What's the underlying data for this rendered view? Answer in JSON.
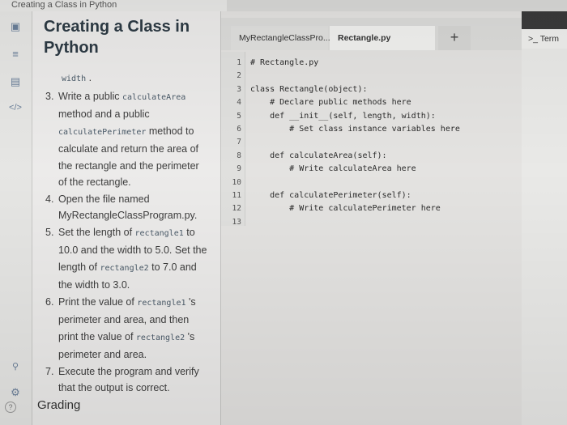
{
  "window": {
    "title": "Creating a Class in Python"
  },
  "lesson": {
    "title_line1": "Creating a Class in",
    "title_line2": "Python",
    "width_code": "width",
    "steps": [
      {
        "num": "3.",
        "t1": "Write a public",
        "c1": "calculateArea",
        "t2": "method and a public",
        "c2": "calculatePerimeter",
        "t3": "method to",
        "t4": "calculate and return the area of",
        "t5": "the rectangle and the perimeter",
        "t6": "of the rectangle."
      },
      {
        "num": "4.",
        "t1": "Open the file named",
        "t2": "MyRectangleClassProgram.py."
      },
      {
        "num": "5.",
        "t1": "Set the length of",
        "c1": "rectangle1",
        "t2": "to",
        "t3": "10.0 and the width to 5.0. Set the",
        "t4": "length of",
        "c2": "rectangle2",
        "t5": "to 7.0 and",
        "t6": "the width to 3.0."
      },
      {
        "num": "6.",
        "t1": "Print the value of",
        "c1": "rectangle1",
        "t2": "'s",
        "t3": "perimeter and area, and then",
        "t4": "print the value of",
        "c2": "rectangle2",
        "t5": "'s",
        "t6": "perimeter and area."
      },
      {
        "num": "7.",
        "t1": "Execute the program and verify",
        "t2": "that the output is correct."
      }
    ],
    "grading": "Grading"
  },
  "editor": {
    "tabs": [
      "MyRectangleClassPro...",
      "Rectangle.py"
    ],
    "add_tab": "+",
    "line_numbers": [
      "1",
      "2",
      "3",
      "4",
      "5",
      "6",
      "7",
      "8",
      "9",
      "10",
      "11",
      "12",
      "13"
    ],
    "code_lines": [
      "# Rectangle.py",
      "",
      "class Rectangle(object):",
      "    # Declare public methods here",
      "    def __init__(self, length, width):",
      "        # Set class instance variables here",
      "",
      "    def calculateArea(self):",
      "        # Write calculateArea here",
      "",
      "    def calculatePerimeter(self):",
      "        # Write calculatePerimeter here",
      ""
    ]
  },
  "terminal": {
    "tab_label": ">_ Term"
  },
  "icons": [
    "book-icon",
    "list-icon",
    "chart-icon",
    "code-icon",
    "share-icon",
    "settings-icon",
    "help-icon"
  ]
}
